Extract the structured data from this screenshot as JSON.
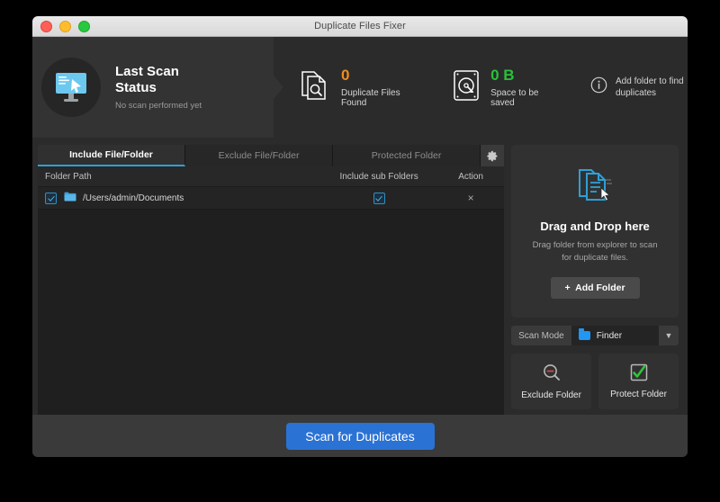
{
  "window": {
    "title": "Duplicate Files Fixer",
    "traffic_lights": [
      "close",
      "minimize",
      "maximize"
    ]
  },
  "header": {
    "status": {
      "icon": "monitor-icon",
      "title": "Last Scan Status",
      "subtitle": "No scan performed yet"
    },
    "stats": [
      {
        "icon": "document-search-icon",
        "value": "0",
        "label": "Duplicate Files Found",
        "color": "#f08b1d"
      },
      {
        "icon": "hard-drive-icon",
        "value": "0 B",
        "label": "Space to be saved",
        "color": "#29c13a"
      }
    ],
    "hint": {
      "icon": "info-icon",
      "text": "Add folder to find duplicates"
    }
  },
  "tabs": [
    {
      "label": "Include File/Folder",
      "active": true
    },
    {
      "label": "Exclude File/Folder",
      "active": false
    },
    {
      "label": "Protected Folder",
      "active": false
    }
  ],
  "settings_button": {
    "icon": "gear-icon"
  },
  "table": {
    "columns": [
      "Folder Path",
      "Include sub Folders",
      "Action"
    ],
    "rows": [
      {
        "selected": true,
        "path": "/Users/admin/Documents",
        "include_sub_folders": true,
        "action": "×"
      }
    ]
  },
  "right_panel": {
    "drop_zone": {
      "icon": "documents-drag-icon",
      "title": "Drag and Drop here",
      "subtitle": "Drag folder from explorer to scan for duplicate files.",
      "add_button": "Add Folder",
      "add_button_icon": "plus-icon"
    },
    "scan_mode": {
      "label": "Scan Mode",
      "value": "Finder",
      "value_icon": "blue-folder-icon",
      "caret_icon": "chevron-down-icon"
    },
    "actions": [
      {
        "icon": "magnifier-minus-icon",
        "label": "Exclude Folder"
      },
      {
        "icon": "green-check-icon",
        "label": "Protect Folder"
      }
    ]
  },
  "footer": {
    "scan_button": "Scan for Duplicates"
  },
  "colors": {
    "accent_blue": "#2a72d4",
    "tab_underline": "#2f9fd6",
    "orange": "#f08b1d",
    "green": "#29c13a",
    "folder_blue": "#2196f3"
  }
}
